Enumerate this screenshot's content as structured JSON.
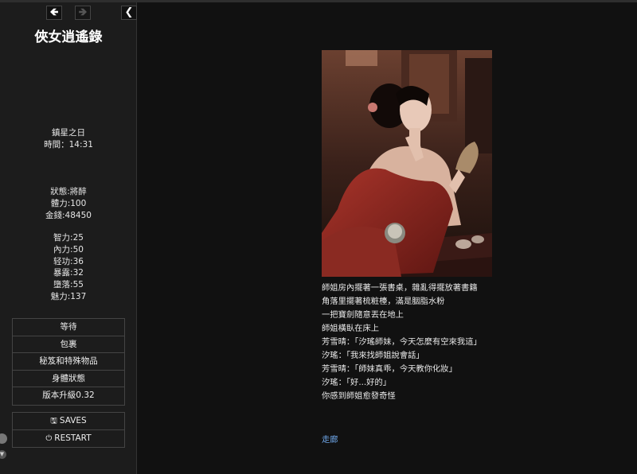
{
  "game_title": "俠女逍遙錄",
  "nav": {
    "back": "🡸",
    "forward": "🡺",
    "collapse": "❮"
  },
  "time": {
    "day": "鎮星之日",
    "clock": "時間：14:31"
  },
  "stats1": [
    "狀態:將醉",
    "體力:100",
    "金錢:48450"
  ],
  "stats2": [
    "智力:25",
    "內力:50",
    "轻功:36",
    "暴露:32",
    "墮落:55",
    "魅力:137"
  ],
  "menu": [
    "等待",
    "包裹",
    "秘笈和特殊物品",
    "身體狀態",
    "版本升級0.32"
  ],
  "saves_label": "SAVES",
  "restart_label": "RESTART",
  "story_lines": [
    "師姐房內擺著一張書桌，雜亂得擺放著書籍",
    "角落里擺著梳粧檯，滿是胭脂水粉",
    "一把寶劍隨意丟在地上",
    "師姐橫臥在床上",
    "芳雪晴：「汐瑤師妹，今天怎麼有空來我這」",
    "汐瑤：「我來找師姐說會話」",
    "芳雪晴：「師妹真乖，今天教你化妝」",
    "汐瑤：「好...好的」",
    "你感到師姐愈發奇怪"
  ],
  "story_link": "走廊",
  "colors": {
    "bg": "#111111",
    "sidebar": "#1c1c1c",
    "link": "#6ea6e8"
  },
  "icons": [
    "arrow-left-icon",
    "arrow-right-icon",
    "chevron-left-icon",
    "floppy-disk-icon",
    "power-icon"
  ]
}
